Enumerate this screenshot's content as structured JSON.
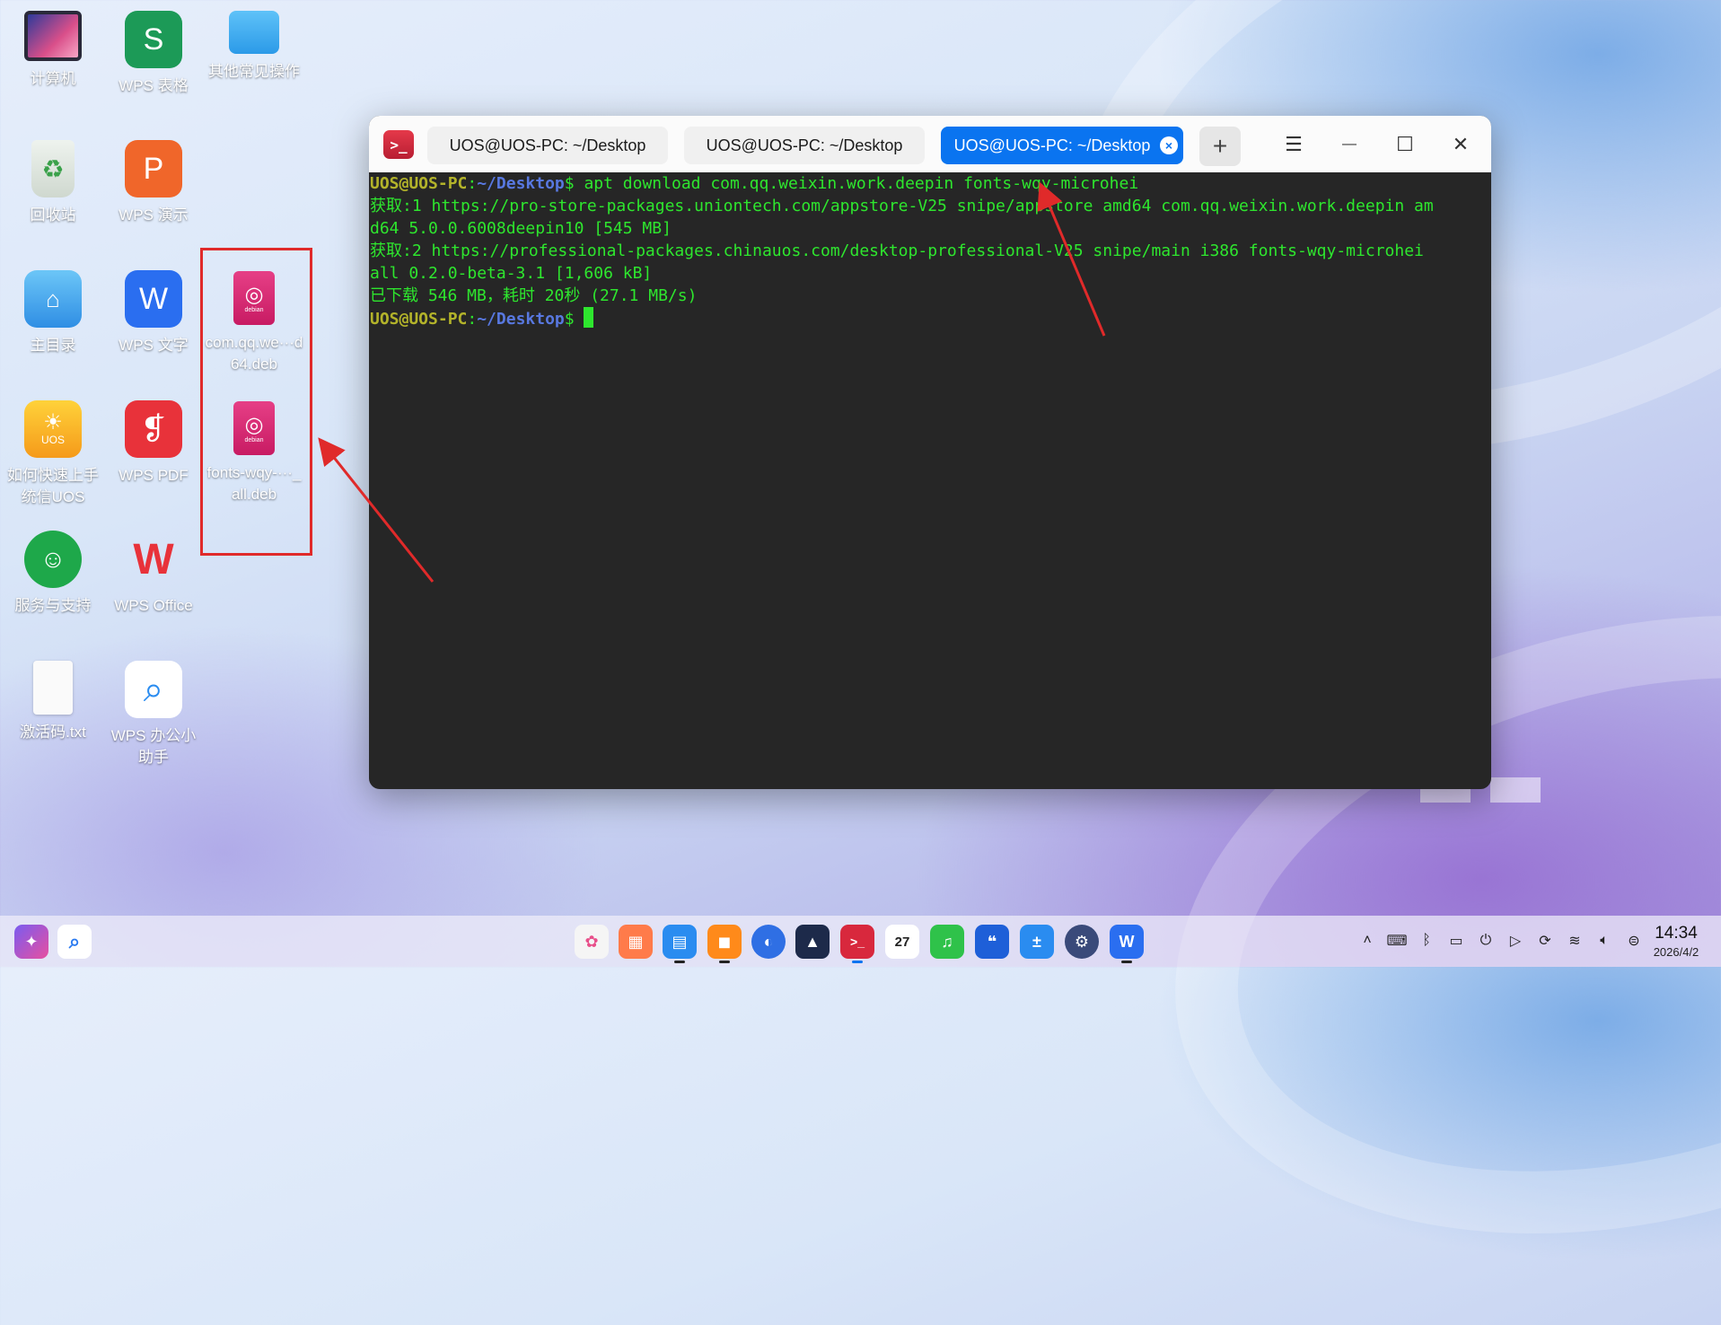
{
  "desktop": {
    "icons": [
      {
        "label": "计算机",
        "icon": "computer-icon"
      },
      {
        "label": "WPS 表格",
        "icon": "wps-sheets-icon",
        "glyph": "S"
      },
      {
        "label": "其他常见操作",
        "icon": "folder-icon"
      },
      {
        "label": "回收站",
        "icon": "recycle-bin-icon"
      },
      {
        "label": "WPS 演示",
        "icon": "wps-presentation-icon",
        "glyph": "P"
      },
      {
        "label": "com.qq.we···d64.deb",
        "icon": "deb-package-icon",
        "badge": "debian"
      },
      {
        "label": "主目录",
        "icon": "home-folder-icon"
      },
      {
        "label": "WPS 文字",
        "icon": "wps-writer-icon",
        "glyph": "W"
      },
      {
        "label": "fonts-wqy-···_all.deb",
        "icon": "deb-package-icon",
        "badge": "debian"
      },
      {
        "label": "如何快速上手统信UOS",
        "icon": "uos-guide-icon",
        "badge": "UOS"
      },
      {
        "label": "WPS PDF",
        "icon": "wps-pdf-icon"
      },
      {
        "label": "服务与支持",
        "icon": "support-icon"
      },
      {
        "label": "WPS Office",
        "icon": "wps-office-icon"
      },
      {
        "label": "激活码.txt",
        "icon": "text-file-icon"
      },
      {
        "label": "WPS 办公小助手",
        "icon": "wps-assistant-icon"
      }
    ]
  },
  "terminal": {
    "tabs": [
      {
        "label": "UOS@UOS-PC: ~/Desktop",
        "active": false
      },
      {
        "label": "UOS@UOS-PC: ~/Desktop",
        "active": false
      },
      {
        "label": "UOS@UOS-PC: ~/Desktop",
        "active": true
      }
    ],
    "add_tab": "+",
    "menu_icon": "☰",
    "minimize_icon": "—",
    "maximize_icon": "☐",
    "close_icon": "✕",
    "prompt_user": "UOS@UOS-PC",
    "prompt_sep": ":",
    "prompt_path": "~/Desktop",
    "prompt_symbol": "$",
    "command": " apt download com.qq.weixin.work.deepin fonts-wqy-microhei",
    "output": [
      "获取:1 https://pro-store-packages.uniontech.com/appstore-V25 snipe/appstore amd64 com.qq.weixin.work.deepin am",
      "d64 5.0.0.6008deepin10 [545 MB]",
      "获取:2 https://professional-packages.chinauos.com/desktop-professional-V25 snipe/main i386 fonts-wqy-microhei",
      "all 0.2.0-beta-3.1 [1,606 kB]",
      "已下载 546 MB，耗时 20秒 (27.1 MB/s)"
    ]
  },
  "taskbar": {
    "left_icons": [
      "launcher-icon",
      "search-icon"
    ],
    "apps": [
      "settings-icon",
      "app-store-icon",
      "file-manager-icon",
      "shopping-bag-icon",
      "browser-icon",
      "editor-icon",
      "terminal-icon",
      "calendar-icon",
      "music-icon",
      "notes-icon",
      "calculator-icon",
      "control-center-icon",
      "wps-writer-icon"
    ],
    "calendar_day": "27",
    "tray": [
      "chevron-up-icon",
      "keyboard-icon",
      "bluetooth-icon",
      "battery-icon",
      "power-icon",
      "play-icon",
      "sync-icon",
      "wifi-icon",
      "volume-icon",
      "toggle-icon"
    ],
    "clock_time": "14:34",
    "clock_date": "2026/4/2"
  },
  "colors": {
    "accent": "#0a74f0",
    "terminal_bg": "#262626",
    "terminal_text": "#2ee62e",
    "annotation_red": "#e02a2a"
  }
}
